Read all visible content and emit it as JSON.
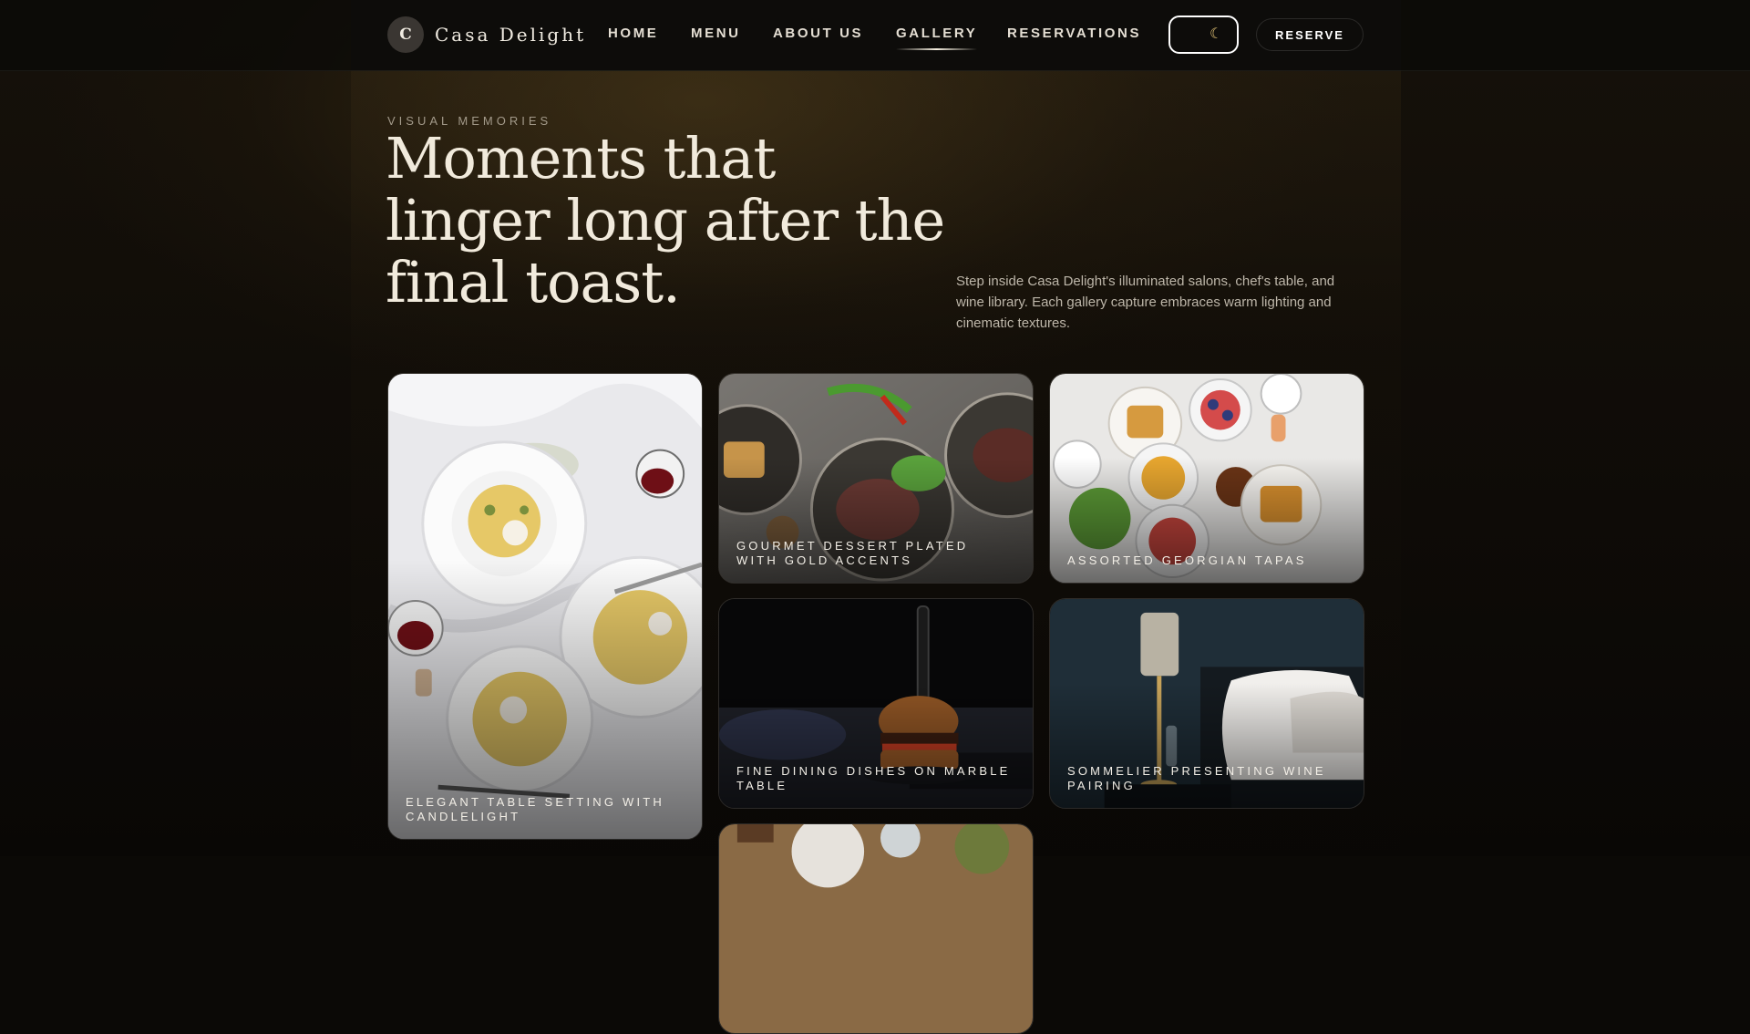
{
  "brand": {
    "initial": "C",
    "name": "Casa Delight"
  },
  "nav": {
    "links": [
      {
        "label": "HOME"
      },
      {
        "label": "MENU"
      },
      {
        "label": "ABOUT US"
      },
      {
        "label": "GALLERY",
        "active": true
      },
      {
        "label": "RESERVATIONS"
      }
    ],
    "theme_icon": "moon-icon",
    "reserve_label": "RESERVE"
  },
  "hero": {
    "eyebrow": "VISUAL MEMORIES",
    "title": "Moments that linger long after the final toast.",
    "intro": "Step inside Casa Delight's illuminated salons, chef's table, and wine library. Each gallery capture embraces warm lighting and cinematic textures."
  },
  "gallery": [
    {
      "caption": "ELEGANT TABLE SETTING WITH CANDLELIGHT"
    },
    {
      "caption": "GOURMET DESSERT PLATED WITH GOLD ACCENTS"
    },
    {
      "caption": "ASSORTED GEORGIAN TAPAS"
    },
    {
      "caption": "FINE DINING DISHES ON MARBLE TABLE"
    },
    {
      "caption": "SOMMELIER PRESENTING WINE PAIRING"
    },
    {
      "caption": ""
    }
  ],
  "colors": {
    "background": "#0b0906",
    "accent_gold": "#e8c878",
    "text_light": "#f1eadc"
  }
}
